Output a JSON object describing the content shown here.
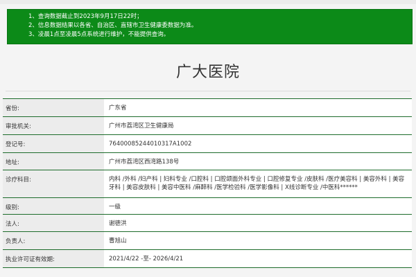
{
  "notice": {
    "lines": [
      "1、查询数据截止到2023年9月17日22时；",
      "2、信息数据结果以各省、自治区、直辖市卫生健康委数据为准。",
      "3、凌晨1点至凌晨5点系统进行维护，不能提供查询。"
    ]
  },
  "hospital": {
    "name": "广大医院"
  },
  "fields": [
    {
      "label": "省份:",
      "value": "广东省"
    },
    {
      "label": "审批机关:",
      "value": "广州市荔湾区卫生健康局"
    },
    {
      "label": "登记号:",
      "value": "76400085244010317A1002"
    },
    {
      "label": "地址:",
      "value": "广州市荔湾区西湾路138号"
    },
    {
      "label": "诊疗科目:",
      "value": "内科 /外科 /妇产科 | 妇科专业 /口腔科 | 口腔颌面外科专业 | 口腔修复专业 /皮肤科 /医疗美容科 | 美容外科 | 美容牙科 | 美容皮肤科 | 美容中医科 /麻醉科 /医学检验科 /医学影像科 | X线诊断专业 /中医科******"
    },
    {
      "label": "级别:",
      "value": "一级"
    },
    {
      "label": "法人:",
      "value": "谢德洪"
    },
    {
      "label": "负责人:",
      "value": "曹旭山"
    },
    {
      "label": "执业许可证有效期:",
      "value": "2021/4/22 -至- 2026/4/21"
    }
  ],
  "colors": {
    "notice_bg": "#0c8a18",
    "row_border": "#1c6b2a"
  }
}
